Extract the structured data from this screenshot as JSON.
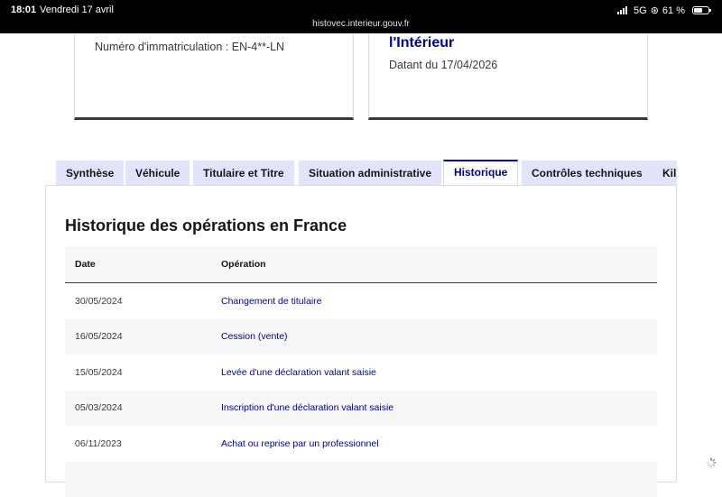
{
  "status_bar": {
    "time": "18:01",
    "date": "Vendredi 17 avril",
    "url": "histovec.interieur.gouv.fr",
    "network": "5G",
    "battery": "61 %",
    "battery_level": 0.61
  },
  "cards": {
    "left": {
      "plate": "Numéro d'immatriculation : EN-4**-LN"
    },
    "right": {
      "title": "l'Intérieur",
      "date": "Datant du 17/04/2026"
    }
  },
  "tabs": [
    {
      "label": "Synthèse",
      "active": false
    },
    {
      "label": "Véhicule",
      "active": false
    },
    {
      "label": "Titulaire et Titre",
      "active": false
    },
    {
      "label": "Situation administrative",
      "active": false
    },
    {
      "label": "Historique",
      "active": true
    },
    {
      "label": "Contrôles techniques",
      "active": false
    },
    {
      "label": "Kilo",
      "active": false
    }
  ],
  "historique": {
    "title": "Historique des opérations en France",
    "columns": {
      "date": "Date",
      "operation": "Opération"
    },
    "rows": [
      {
        "date": "30/05/2024",
        "operation": "Changement de titulaire"
      },
      {
        "date": "16/05/2024",
        "operation": "Cession (vente)"
      },
      {
        "date": "15/05/2024",
        "operation": "Levée d'une déclaration valant saisie"
      },
      {
        "date": "05/03/2024",
        "operation": "Inscription d'une déclaration valant saisie"
      },
      {
        "date": "06/11/2023",
        "operation": "Achat ou reprise par un professionnel"
      },
      {
        "date": "",
        "operation": ""
      }
    ]
  },
  "colors": {
    "accent": "#000091",
    "tab_bg": "#e3e3fd",
    "row_alt": "#f6f6f6"
  }
}
